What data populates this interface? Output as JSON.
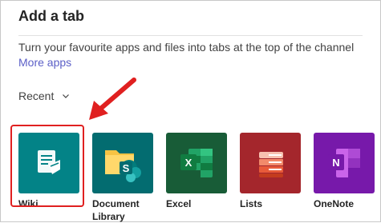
{
  "dialog": {
    "title": "Add a tab",
    "description": "Turn your favourite apps and files into tabs at the top of the channel",
    "more_apps": "More apps",
    "recent_label": "Recent"
  },
  "apps": [
    {
      "label": "Wiki",
      "color": "#038387",
      "icon": "wiki-icon"
    },
    {
      "label_line1": "Document",
      "label_line2": "Library",
      "color": "#036c70",
      "icon": "document-library-icon"
    },
    {
      "label": "Excel",
      "color": "#185c37",
      "icon": "excel-icon"
    },
    {
      "label": "Lists",
      "color": "#a4262c",
      "icon": "lists-icon"
    },
    {
      "label": "OneNote",
      "color": "#7719aa",
      "icon": "onenote-icon"
    }
  ],
  "annotation": {
    "color": "#e02020"
  }
}
